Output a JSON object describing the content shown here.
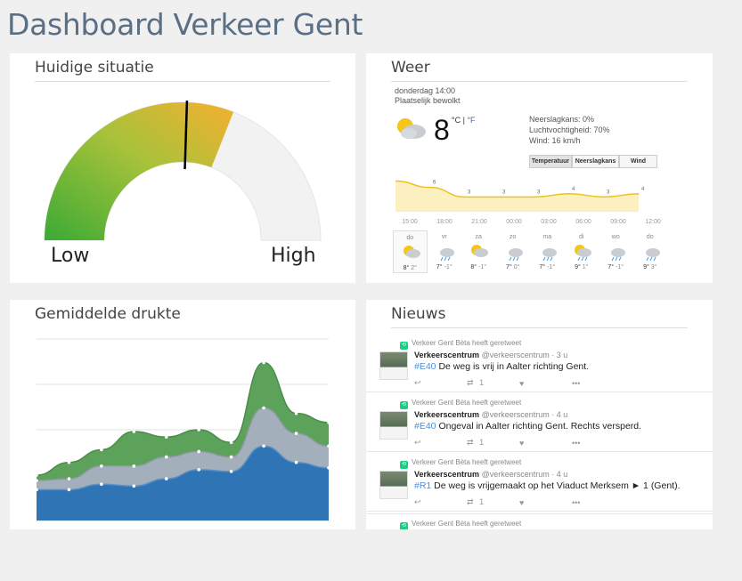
{
  "page": {
    "title": "Dashboard Verkeer Gent"
  },
  "gauge": {
    "title": "Huidige situatie",
    "low_label": "Low",
    "high_label": "High",
    "level": 0.62
  },
  "weather": {
    "title": "Weer",
    "datetime": "donderdag 14:00",
    "condition": "Plaatselijk bewolkt",
    "temperature": "8",
    "unit_c": "°C",
    "unit_sep": " | ",
    "unit_f": "°F",
    "precip": "Neerslagkans: 0%",
    "humidity": "Luchtvochtigheid: 70%",
    "wind": "Wind: 16 km/h",
    "tabs": [
      "Temperatuur",
      "Neerslagkans",
      "Wind"
    ],
    "hourly_times": [
      "15:00",
      "18:00",
      "21:00",
      "00:00",
      "03:00",
      "06:00",
      "09:00",
      "12:00"
    ],
    "hourly_values": [
      "8",
      "6",
      "3",
      "3",
      "3",
      "4",
      "3",
      "4"
    ],
    "days": [
      {
        "name": "do",
        "hi": "8°",
        "lo": "2°",
        "icon": "sun-cloud-icon"
      },
      {
        "name": "vr",
        "hi": "7°",
        "lo": "-1°",
        "icon": "rain-cloud-icon"
      },
      {
        "name": "za",
        "hi": "8°",
        "lo": "-1°",
        "icon": "sun-cloud-icon"
      },
      {
        "name": "zo",
        "hi": "7°",
        "lo": "0°",
        "icon": "rain-cloud-icon"
      },
      {
        "name": "ma",
        "hi": "7°",
        "lo": "-1°",
        "icon": "rain-cloud-icon"
      },
      {
        "name": "di",
        "hi": "9°",
        "lo": "1°",
        "icon": "sun-rain-icon"
      },
      {
        "name": "wo",
        "hi": "7°",
        "lo": "-1°",
        "icon": "rain-cloud-icon"
      },
      {
        "name": "do",
        "hi": "9°",
        "lo": "3°",
        "icon": "rain-cloud-icon"
      }
    ]
  },
  "drukte": {
    "title": "Gemiddelde drukte"
  },
  "news": {
    "title": "Nieuws",
    "tweets": [
      {
        "retweet": "Verkeer Gent Bèta heeft geretweet",
        "name": "Verkeerscentrum",
        "handle": "@verkeerscentrum",
        "time": "· 3 u",
        "hashtag": "#E40",
        "text": " De weg is vrij in Aalter richting Gent.",
        "retweets": "1"
      },
      {
        "retweet": "Verkeer Gent Bèta heeft geretweet",
        "name": "Verkeerscentrum",
        "handle": "@verkeerscentrum",
        "time": "· 4 u",
        "hashtag": "#E40",
        "text": " Ongeval in Aalter richting Gent. Rechts versperd.",
        "retweets": "1"
      },
      {
        "retweet": "Verkeer Gent Bèta heeft geretweet",
        "name": "Verkeerscentrum",
        "handle": "@verkeerscentrum",
        "time": "· 4 u",
        "hashtag": "#R1",
        "text": " De weg is vrijgemaakt op het Viaduct Merksem ► 1 (Gent).",
        "retweets": "1"
      },
      {
        "retweet": "Verkeer Gent Bèta heeft geretweet"
      }
    ]
  },
  "chart_data": {
    "type": "area",
    "stacked": true,
    "x": [
      0,
      1,
      2,
      3,
      4,
      5,
      6,
      7,
      8,
      9
    ],
    "series": [
      {
        "values": [
          17,
          17,
          20,
          19,
          23,
          28,
          27,
          41,
          32,
          29
        ],
        "color": "#2f75b5"
      },
      {
        "values": [
          5,
          6,
          10,
          11,
          12,
          10,
          8,
          21,
          16,
          12
        ],
        "color": "#a3b0bc"
      },
      {
        "values": [
          3,
          9,
          9,
          19,
          11,
          12,
          8,
          25,
          11,
          13
        ],
        "color": "#5ca25a"
      }
    ],
    "ylim": [
      0,
      100
    ],
    "grid": true
  }
}
